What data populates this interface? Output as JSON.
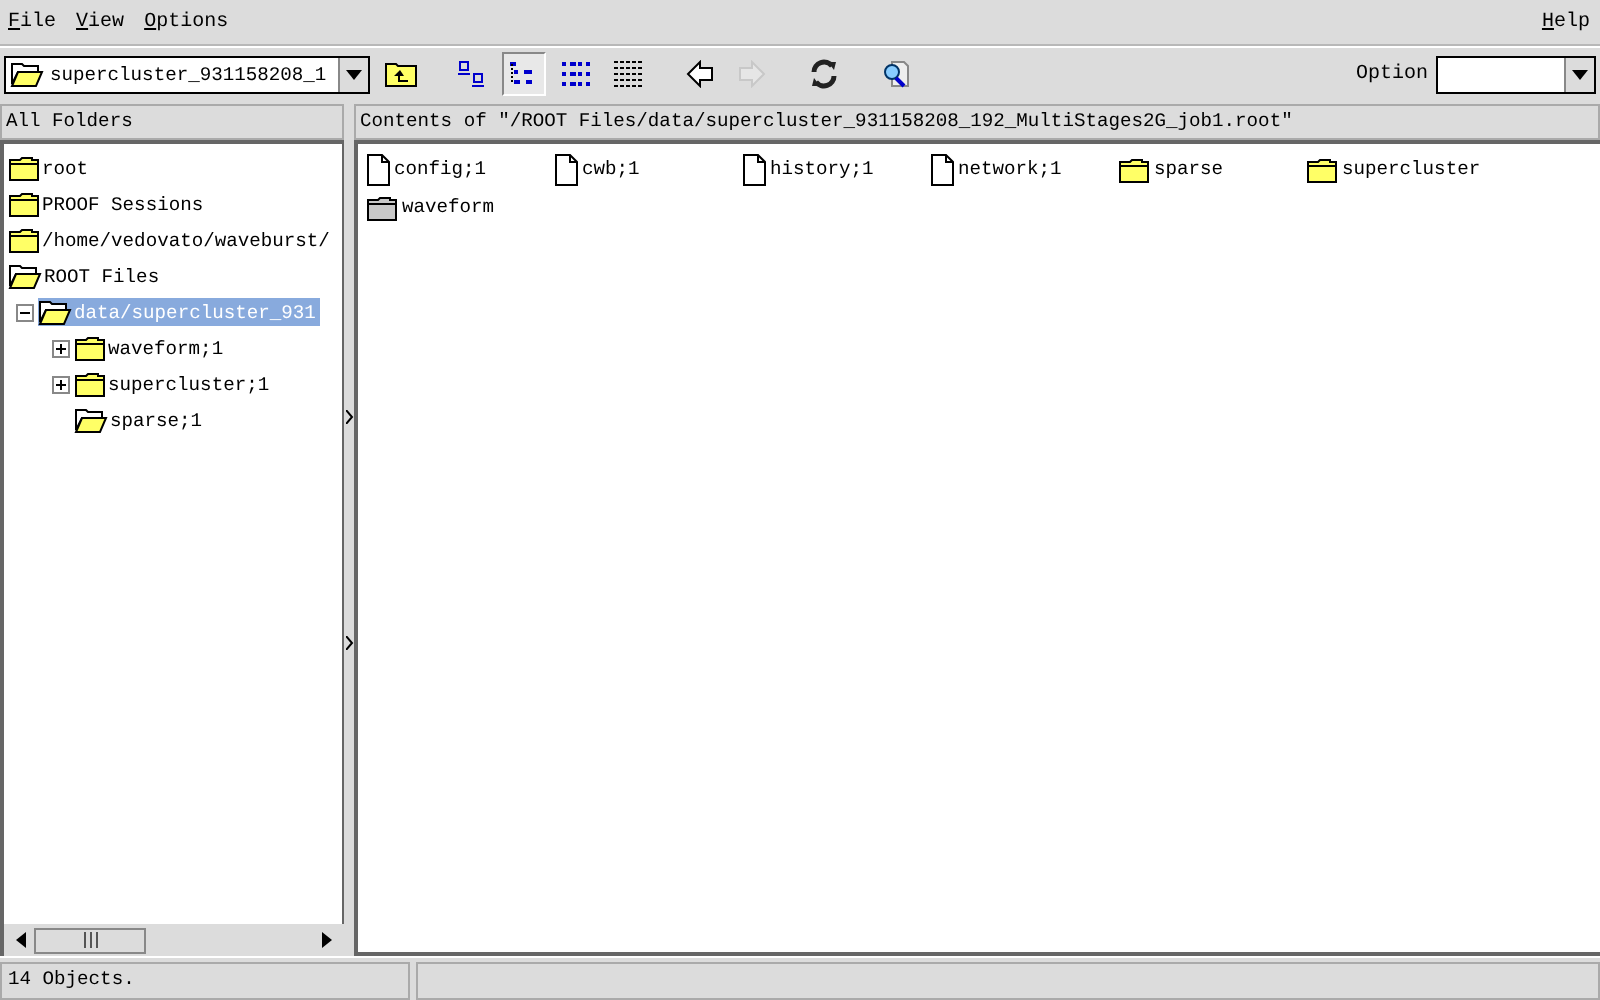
{
  "menu_left": [
    "File",
    "View",
    "Options"
  ],
  "menu_right": [
    "Help"
  ],
  "toolbar": {
    "path_combo": "supercluster_931158208_1",
    "buttons": [
      {
        "kind": "folder-up",
        "selected": false,
        "disabled": false
      },
      {
        "kind": "large-icons",
        "selected": false,
        "disabled": false
      },
      {
        "kind": "small-icons",
        "selected": true,
        "disabled": false
      },
      {
        "kind": "list",
        "selected": false,
        "disabled": false
      },
      {
        "kind": "details",
        "selected": false,
        "disabled": false
      },
      {
        "kind": "back",
        "selected": false,
        "disabled": false
      },
      {
        "kind": "forward",
        "selected": false,
        "disabled": true
      },
      {
        "kind": "refresh",
        "selected": false,
        "disabled": false
      },
      {
        "kind": "find",
        "selected": false,
        "disabled": false
      }
    ],
    "option_label": "Option"
  },
  "folders": {
    "title": "All Folders",
    "tree": [
      {
        "label": "root",
        "kind": "folder",
        "selected": false
      },
      {
        "label": "PROOF Sessions",
        "kind": "folder",
        "selected": false
      },
      {
        "label": "/home/vedovato/waveburst/",
        "kind": "folder",
        "selected": false
      },
      {
        "label": "ROOT Files",
        "kind": "open-folder",
        "selected": false,
        "children": [
          {
            "label": "data/supercluster_931",
            "kind": "open-folder",
            "selected": true,
            "expanded": true,
            "children": [
              {
                "label": "waveform;1",
                "kind": "folder",
                "selected": false,
                "expanded": false
              },
              {
                "label": "supercluster;1",
                "kind": "folder",
                "selected": false,
                "expanded": false
              },
              {
                "label": "sparse;1",
                "kind": "open-folder",
                "selected": false
              }
            ]
          }
        ]
      }
    ]
  },
  "contents": {
    "title": "Contents of \"/ROOT Files/data/supercluster_931158208_192_MultiStages2G_job1.root\"",
    "items": [
      {
        "label": "config;1",
        "kind": "file"
      },
      {
        "label": "cwb;1",
        "kind": "file"
      },
      {
        "label": "history;1",
        "kind": "file"
      },
      {
        "label": "network;1",
        "kind": "file"
      },
      {
        "label": "sparse",
        "kind": "folder"
      },
      {
        "label": "supercluster",
        "kind": "folder"
      },
      {
        "label": "waveform",
        "kind": "grey-folder"
      }
    ]
  },
  "status_bar": {
    "text": "14 Objects."
  }
}
